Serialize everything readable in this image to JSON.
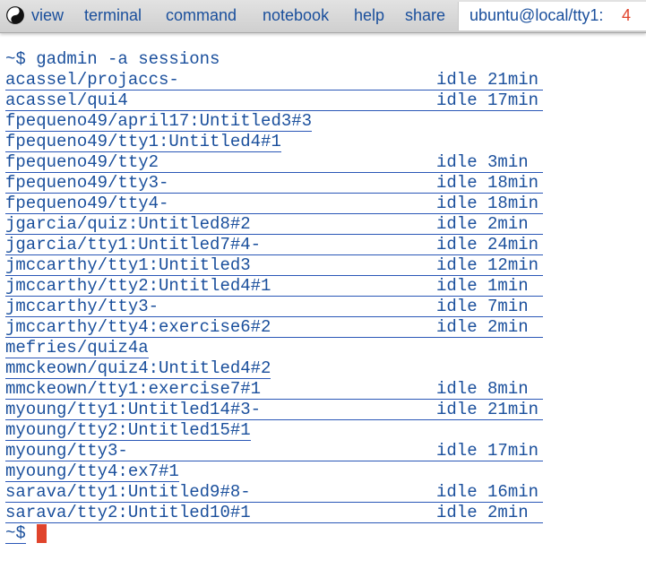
{
  "menubar": {
    "items": [
      {
        "label": "view"
      },
      {
        "label": "terminal"
      },
      {
        "label": "command"
      },
      {
        "label": "notebook"
      },
      {
        "label": "help"
      },
      {
        "label": "share"
      }
    ],
    "host": "ubuntu@local/tty1:",
    "tab_count": "4"
  },
  "terminal": {
    "command_line": "~$ gadmin -a sessions",
    "sessions": [
      {
        "name": "acassel/projaccs-",
        "status": "idle 21min"
      },
      {
        "name": "acassel/qui4",
        "status": "idle 17min"
      },
      {
        "name": "fpequeno49/april17:Untitled3#3",
        "status": ""
      },
      {
        "name": "fpequeno49/tty1:Untitled4#1",
        "status": ""
      },
      {
        "name": "fpequeno49/tty2",
        "status": "idle 3min"
      },
      {
        "name": "fpequeno49/tty3-",
        "status": "idle 18min"
      },
      {
        "name": "fpequeno49/tty4-",
        "status": "idle 18min"
      },
      {
        "name": "jgarcia/quiz:Untitled8#2",
        "status": "idle 2min"
      },
      {
        "name": "jgarcia/tty1:Untitled7#4-",
        "status": "idle 24min"
      },
      {
        "name": "jmccarthy/tty1:Untitled3",
        "status": "idle 12min"
      },
      {
        "name": "jmccarthy/tty2:Untitled4#1",
        "status": "idle 1min"
      },
      {
        "name": "jmccarthy/tty3-",
        "status": "idle 7min"
      },
      {
        "name": "jmccarthy/tty4:exercise6#2",
        "status": "idle 2min"
      },
      {
        "name": "mefries/quiz4a",
        "status": ""
      },
      {
        "name": "mmckeown/quiz4:Untitled4#2",
        "status": ""
      },
      {
        "name": "mmckeown/tty1:exercise7#1",
        "status": "idle 8min"
      },
      {
        "name": "myoung/tty1:Untitled14#3-",
        "status": "idle 21min"
      },
      {
        "name": "myoung/tty2:Untitled15#1",
        "status": ""
      },
      {
        "name": "myoung/tty3-",
        "status": "idle 17min"
      },
      {
        "name": "myoung/tty4:ex7#1",
        "status": ""
      },
      {
        "name": "sarava/tty1:Untitled9#8-",
        "status": "idle 16min"
      },
      {
        "name": "sarava/tty2:Untitled10#1",
        "status": "idle 2min"
      }
    ],
    "prompt": "~$"
  },
  "colors": {
    "text": "#1a4f9c",
    "link_underline": "#2a57b7",
    "cursor": "#e0442c",
    "tab_count": "#e0442c"
  }
}
